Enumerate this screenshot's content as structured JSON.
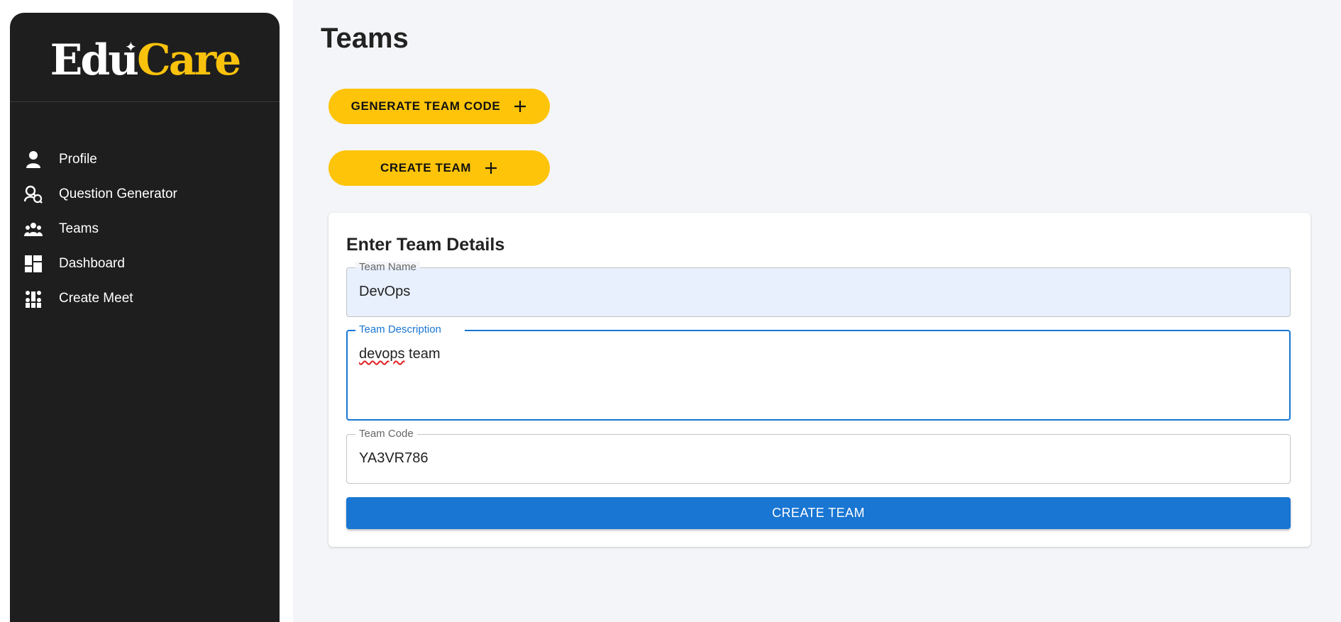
{
  "brand": {
    "part1": "Edu",
    "part2": "Care"
  },
  "sidebar": {
    "items": [
      {
        "label": "Profile",
        "icon": "person-icon"
      },
      {
        "label": "Question Generator",
        "icon": "question-search-icon"
      },
      {
        "label": "Teams",
        "icon": "groups-icon"
      },
      {
        "label": "Dashboard",
        "icon": "dashboard-icon"
      },
      {
        "label": "Create Meet",
        "icon": "meeting-icon"
      }
    ]
  },
  "page": {
    "title": "Teams"
  },
  "actions": {
    "generate_code_label": "GENERATE TEAM CODE",
    "create_team_label": "CREATE TEAM"
  },
  "form": {
    "title": "Enter Team Details",
    "team_name": {
      "label": "Team Name",
      "value": "DevOps"
    },
    "team_description": {
      "label": "Team Description",
      "value_word1": "devops",
      "value_word2": " team"
    },
    "team_code": {
      "label": "Team Code",
      "value": "YA3VR786"
    },
    "submit_label": "CREATE TEAM"
  },
  "colors": {
    "sidebar_bg": "#1e1e1e",
    "accent_yellow": "#fec40a",
    "primary_blue": "#1976d2",
    "page_bg": "#f4f5f8"
  }
}
